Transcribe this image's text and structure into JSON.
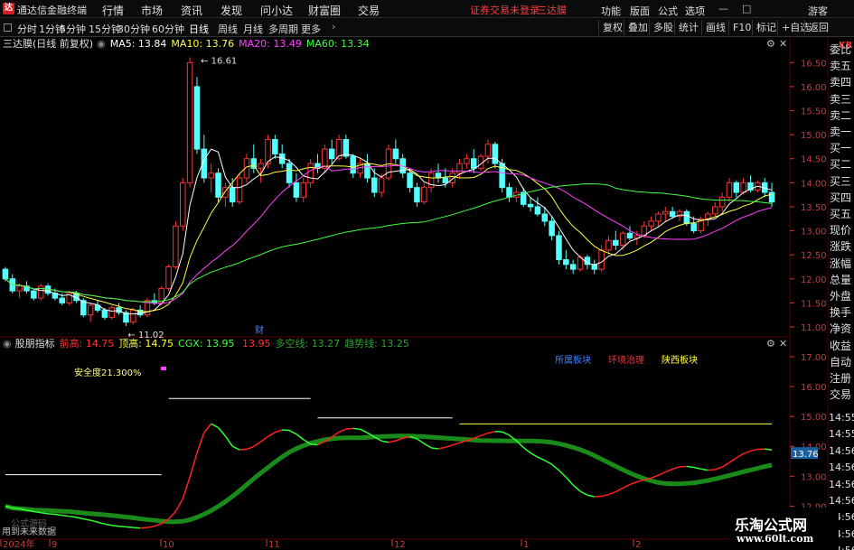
{
  "titlebar": {
    "logo_char": "达",
    "app_name": "通达信金融终端",
    "menus": [
      "行情",
      "市场",
      "资讯",
      "发现",
      "问小达",
      "财富圈",
      "交易"
    ],
    "notice": "证券交易未登录",
    "stock": "三达膜",
    "right_menus": [
      "功能",
      "版面",
      "公式",
      "选项"
    ],
    "guest": "游客"
  },
  "toolbar": {
    "periods": [
      "分时",
      "1分钟",
      "5分钟",
      "15分钟",
      "30分钟",
      "60分钟",
      "日线",
      "周线",
      "月线",
      "多周期",
      "更多"
    ],
    "active_period": "日线",
    "right_buttons": [
      "复权",
      "叠加",
      "多股",
      "统计",
      "画线",
      "F10",
      "标记",
      "+自选",
      "返回"
    ]
  },
  "main_chart": {
    "title": "三达膜(日线 前复权)",
    "ma": [
      {
        "label": "MA5:",
        "value": "13.84",
        "color": "#ffffff"
      },
      {
        "label": "MA10:",
        "value": "13.76",
        "color": "#ffff40"
      },
      {
        "label": "MA20:",
        "value": "13.49",
        "color": "#ff40ff"
      },
      {
        "label": "MA60:",
        "value": "13.34",
        "color": "#40ff40"
      }
    ],
    "high_label": "16.61",
    "low_label": "11.02",
    "event_marker": "财",
    "y_ticks": [
      "16.50",
      "16.00",
      "15.50",
      "15.00",
      "14.50",
      "14.00",
      "13.50",
      "13.00",
      "12.50",
      "12.00",
      "11.50",
      "11.00"
    ]
  },
  "indicator": {
    "name": "股朋指标",
    "items": [
      {
        "label": "前高:",
        "value": "14.75",
        "color": "#ff3030"
      },
      {
        "label": "顶高:",
        "value": "14.75",
        "color": "#ffff40"
      },
      {
        "label": "CGX:",
        "value": "13.95",
        "color": "#40ff40"
      },
      {
        "label": "",
        "value": "13.95",
        "color": "#ff3030"
      },
      {
        "label": "多空线:",
        "value": "13.27",
        "color": "#30a030"
      },
      {
        "label": "趋势线:",
        "value": "13.25",
        "color": "#30a030"
      }
    ],
    "safety": "安全度21.300%",
    "tags": [
      {
        "text": "所属板块",
        "color": "#4080ff"
      },
      {
        "text": "环境治理",
        "color": "#ff3030"
      },
      {
        "text": "陕西板块",
        "color": "#ffff40"
      }
    ],
    "price_tag": "13.76",
    "y_ticks": [
      "17.00",
      "16.00",
      "15.00",
      "14.00",
      "13.00",
      "12.00"
    ],
    "footer_1": "公式源码",
    "footer_2": "用到未来数据"
  },
  "xaxis": {
    "labels": [
      "2024年",
      "9",
      "10",
      "11",
      "12",
      "1",
      "2"
    ]
  },
  "side_panel": {
    "header": "KR",
    "items": [
      "委比",
      "卖五",
      "卖四",
      "卖三",
      "卖二",
      "卖一",
      "买一",
      "买二",
      "买三",
      "买四",
      "买五",
      "现价",
      "涨跌",
      "涨幅",
      "总量",
      "外盘",
      "换手",
      "净资",
      "收益",
      "自动",
      "注册",
      "交易"
    ],
    "times": [
      "14:55",
      "14:55",
      "14:56",
      "14:56",
      "14:56",
      "14:56",
      "14:56",
      "14:56",
      "14:56"
    ]
  },
  "watermark": {
    "line1": "乐淘公式网",
    "line2": "www.60lt.com"
  },
  "colors": {
    "up": "#ff3232",
    "down": "#54ffff",
    "grid": "#5a0000",
    "axis_text": "#c83c3c"
  },
  "chart_data": {
    "type": "candlestick",
    "timeframe": "daily",
    "ohlc": [
      [
        12.2,
        12.25,
        11.95,
        12.0
      ],
      [
        12.0,
        12.1,
        11.7,
        11.75
      ],
      [
        11.75,
        11.9,
        11.6,
        11.85
      ],
      [
        11.85,
        11.95,
        11.7,
        11.75
      ],
      [
        11.75,
        11.8,
        11.55,
        11.6
      ],
      [
        11.6,
        11.9,
        11.55,
        11.85
      ],
      [
        11.85,
        11.9,
        11.65,
        11.7
      ],
      [
        11.7,
        11.8,
        11.55,
        11.6
      ],
      [
        11.6,
        11.7,
        11.45,
        11.5
      ],
      [
        11.5,
        11.75,
        11.45,
        11.7
      ],
      [
        11.7,
        11.75,
        11.5,
        11.55
      ],
      [
        11.55,
        11.6,
        11.2,
        11.25
      ],
      [
        11.25,
        11.5,
        11.1,
        11.45
      ],
      [
        11.45,
        11.55,
        11.3,
        11.35
      ],
      [
        11.35,
        11.4,
        11.15,
        11.2
      ],
      [
        11.2,
        11.45,
        11.15,
        11.4
      ],
      [
        11.4,
        11.5,
        11.25,
        11.3
      ],
      [
        11.3,
        11.35,
        11.02,
        11.1
      ],
      [
        11.1,
        11.4,
        11.05,
        11.35
      ],
      [
        11.35,
        11.45,
        11.2,
        11.25
      ],
      [
        11.25,
        11.6,
        11.2,
        11.55
      ],
      [
        11.55,
        11.7,
        11.45,
        11.5
      ],
      [
        11.5,
        11.85,
        11.45,
        11.8
      ],
      [
        11.8,
        12.3,
        11.75,
        12.25
      ],
      [
        12.25,
        13.2,
        12.2,
        13.1
      ],
      [
        13.1,
        14.1,
        13.0,
        14.0
      ],
      [
        14.0,
        16.61,
        13.9,
        16.5
      ],
      [
        16.0,
        16.2,
        14.6,
        14.7
      ],
      [
        14.7,
        15.0,
        14.0,
        14.1
      ],
      [
        14.1,
        14.4,
        13.8,
        14.2
      ],
      [
        14.2,
        14.3,
        13.6,
        13.7
      ],
      [
        13.7,
        14.0,
        13.5,
        13.9
      ],
      [
        13.9,
        14.1,
        13.5,
        13.6
      ],
      [
        13.6,
        14.2,
        13.55,
        14.1
      ],
      [
        14.1,
        14.6,
        14.0,
        14.5
      ],
      [
        14.5,
        14.8,
        14.2,
        14.3
      ],
      [
        14.3,
        14.5,
        14.0,
        14.4
      ],
      [
        14.4,
        15.0,
        14.3,
        14.9
      ],
      [
        14.9,
        15.0,
        14.5,
        14.6
      ],
      [
        14.6,
        14.8,
        14.3,
        14.4
      ],
      [
        14.4,
        14.5,
        13.9,
        14.0
      ],
      [
        14.0,
        14.2,
        13.6,
        13.7
      ],
      [
        13.7,
        14.1,
        13.6,
        14.0
      ],
      [
        14.0,
        14.5,
        13.9,
        14.4
      ],
      [
        14.4,
        14.6,
        14.2,
        14.3
      ],
      [
        14.3,
        14.8,
        14.2,
        14.7
      ],
      [
        14.7,
        14.9,
        14.4,
        14.5
      ],
      [
        14.5,
        15.0,
        14.45,
        14.9
      ],
      [
        14.9,
        15.0,
        14.5,
        14.55
      ],
      [
        14.55,
        14.6,
        14.1,
        14.2
      ],
      [
        14.2,
        14.5,
        14.1,
        14.4
      ],
      [
        14.4,
        14.6,
        14.0,
        14.1
      ],
      [
        14.1,
        14.3,
        13.7,
        13.8
      ],
      [
        13.8,
        14.2,
        13.7,
        14.1
      ],
      [
        14.1,
        14.8,
        14.05,
        14.7
      ],
      [
        14.7,
        14.9,
        14.4,
        14.5
      ],
      [
        14.5,
        14.6,
        14.1,
        14.2
      ],
      [
        14.2,
        14.3,
        13.8,
        13.9
      ],
      [
        13.9,
        14.0,
        13.5,
        13.6
      ],
      [
        13.6,
        14.0,
        13.55,
        13.9
      ],
      [
        13.9,
        14.3,
        13.8,
        14.2
      ],
      [
        14.2,
        14.4,
        14.0,
        14.1
      ],
      [
        14.1,
        14.3,
        13.9,
        14.0
      ],
      [
        14.0,
        14.3,
        13.9,
        14.2
      ],
      [
        14.2,
        14.5,
        14.1,
        14.4
      ],
      [
        14.4,
        14.6,
        14.3,
        14.5
      ],
      [
        14.5,
        14.7,
        14.2,
        14.3
      ],
      [
        14.3,
        14.6,
        14.25,
        14.55
      ],
      [
        14.55,
        14.9,
        14.4,
        14.8
      ],
      [
        14.8,
        14.85,
        14.3,
        14.4
      ],
      [
        14.4,
        14.5,
        13.8,
        13.9
      ],
      [
        13.9,
        14.0,
        13.6,
        13.7
      ],
      [
        13.7,
        13.9,
        13.6,
        13.8
      ],
      [
        13.8,
        13.9,
        13.5,
        13.55
      ],
      [
        13.55,
        13.7,
        13.4,
        13.5
      ],
      [
        13.5,
        13.7,
        13.3,
        13.35
      ],
      [
        13.35,
        13.5,
        13.1,
        13.2
      ],
      [
        13.2,
        13.3,
        12.8,
        12.9
      ],
      [
        12.9,
        13.0,
        12.3,
        12.4
      ],
      [
        12.4,
        12.6,
        12.2,
        12.3
      ],
      [
        12.3,
        12.4,
        12.1,
        12.2
      ],
      [
        12.2,
        12.5,
        12.15,
        12.45
      ],
      [
        12.45,
        12.5,
        12.2,
        12.3
      ],
      [
        12.3,
        12.4,
        12.1,
        12.2
      ],
      [
        12.2,
        12.7,
        12.15,
        12.6
      ],
      [
        12.6,
        12.9,
        12.5,
        12.8
      ],
      [
        12.8,
        13.0,
        12.6,
        12.7
      ],
      [
        12.7,
        13.0,
        12.6,
        12.95
      ],
      [
        12.95,
        13.1,
        12.8,
        12.85
      ],
      [
        12.85,
        13.0,
        12.7,
        12.9
      ],
      [
        12.9,
        13.2,
        12.85,
        13.1
      ],
      [
        13.1,
        13.3,
        13.0,
        13.2
      ],
      [
        13.2,
        13.4,
        13.1,
        13.35
      ],
      [
        13.35,
        13.5,
        13.2,
        13.4
      ],
      [
        13.4,
        13.5,
        13.25,
        13.3
      ],
      [
        13.3,
        13.45,
        13.2,
        13.4
      ],
      [
        13.4,
        13.45,
        13.1,
        13.15
      ],
      [
        13.15,
        13.3,
        12.95,
        13.0
      ],
      [
        13.0,
        13.3,
        12.95,
        13.25
      ],
      [
        13.25,
        13.4,
        13.1,
        13.35
      ],
      [
        13.35,
        13.6,
        13.3,
        13.5
      ],
      [
        13.5,
        13.8,
        13.4,
        13.7
      ],
      [
        13.7,
        14.1,
        13.6,
        14.0
      ],
      [
        14.0,
        14.05,
        13.7,
        13.8
      ],
      [
        13.8,
        14.1,
        13.75,
        14.0
      ],
      [
        14.0,
        14.15,
        13.8,
        13.85
      ],
      [
        13.85,
        14.05,
        13.8,
        14.0
      ],
      [
        14.0,
        14.1,
        13.7,
        13.8
      ],
      [
        13.8,
        14.0,
        13.5,
        13.6
      ]
    ],
    "y_range": [
      10.85,
      16.75
    ],
    "indicator_y_range": [
      11.8,
      17.3
    ]
  }
}
